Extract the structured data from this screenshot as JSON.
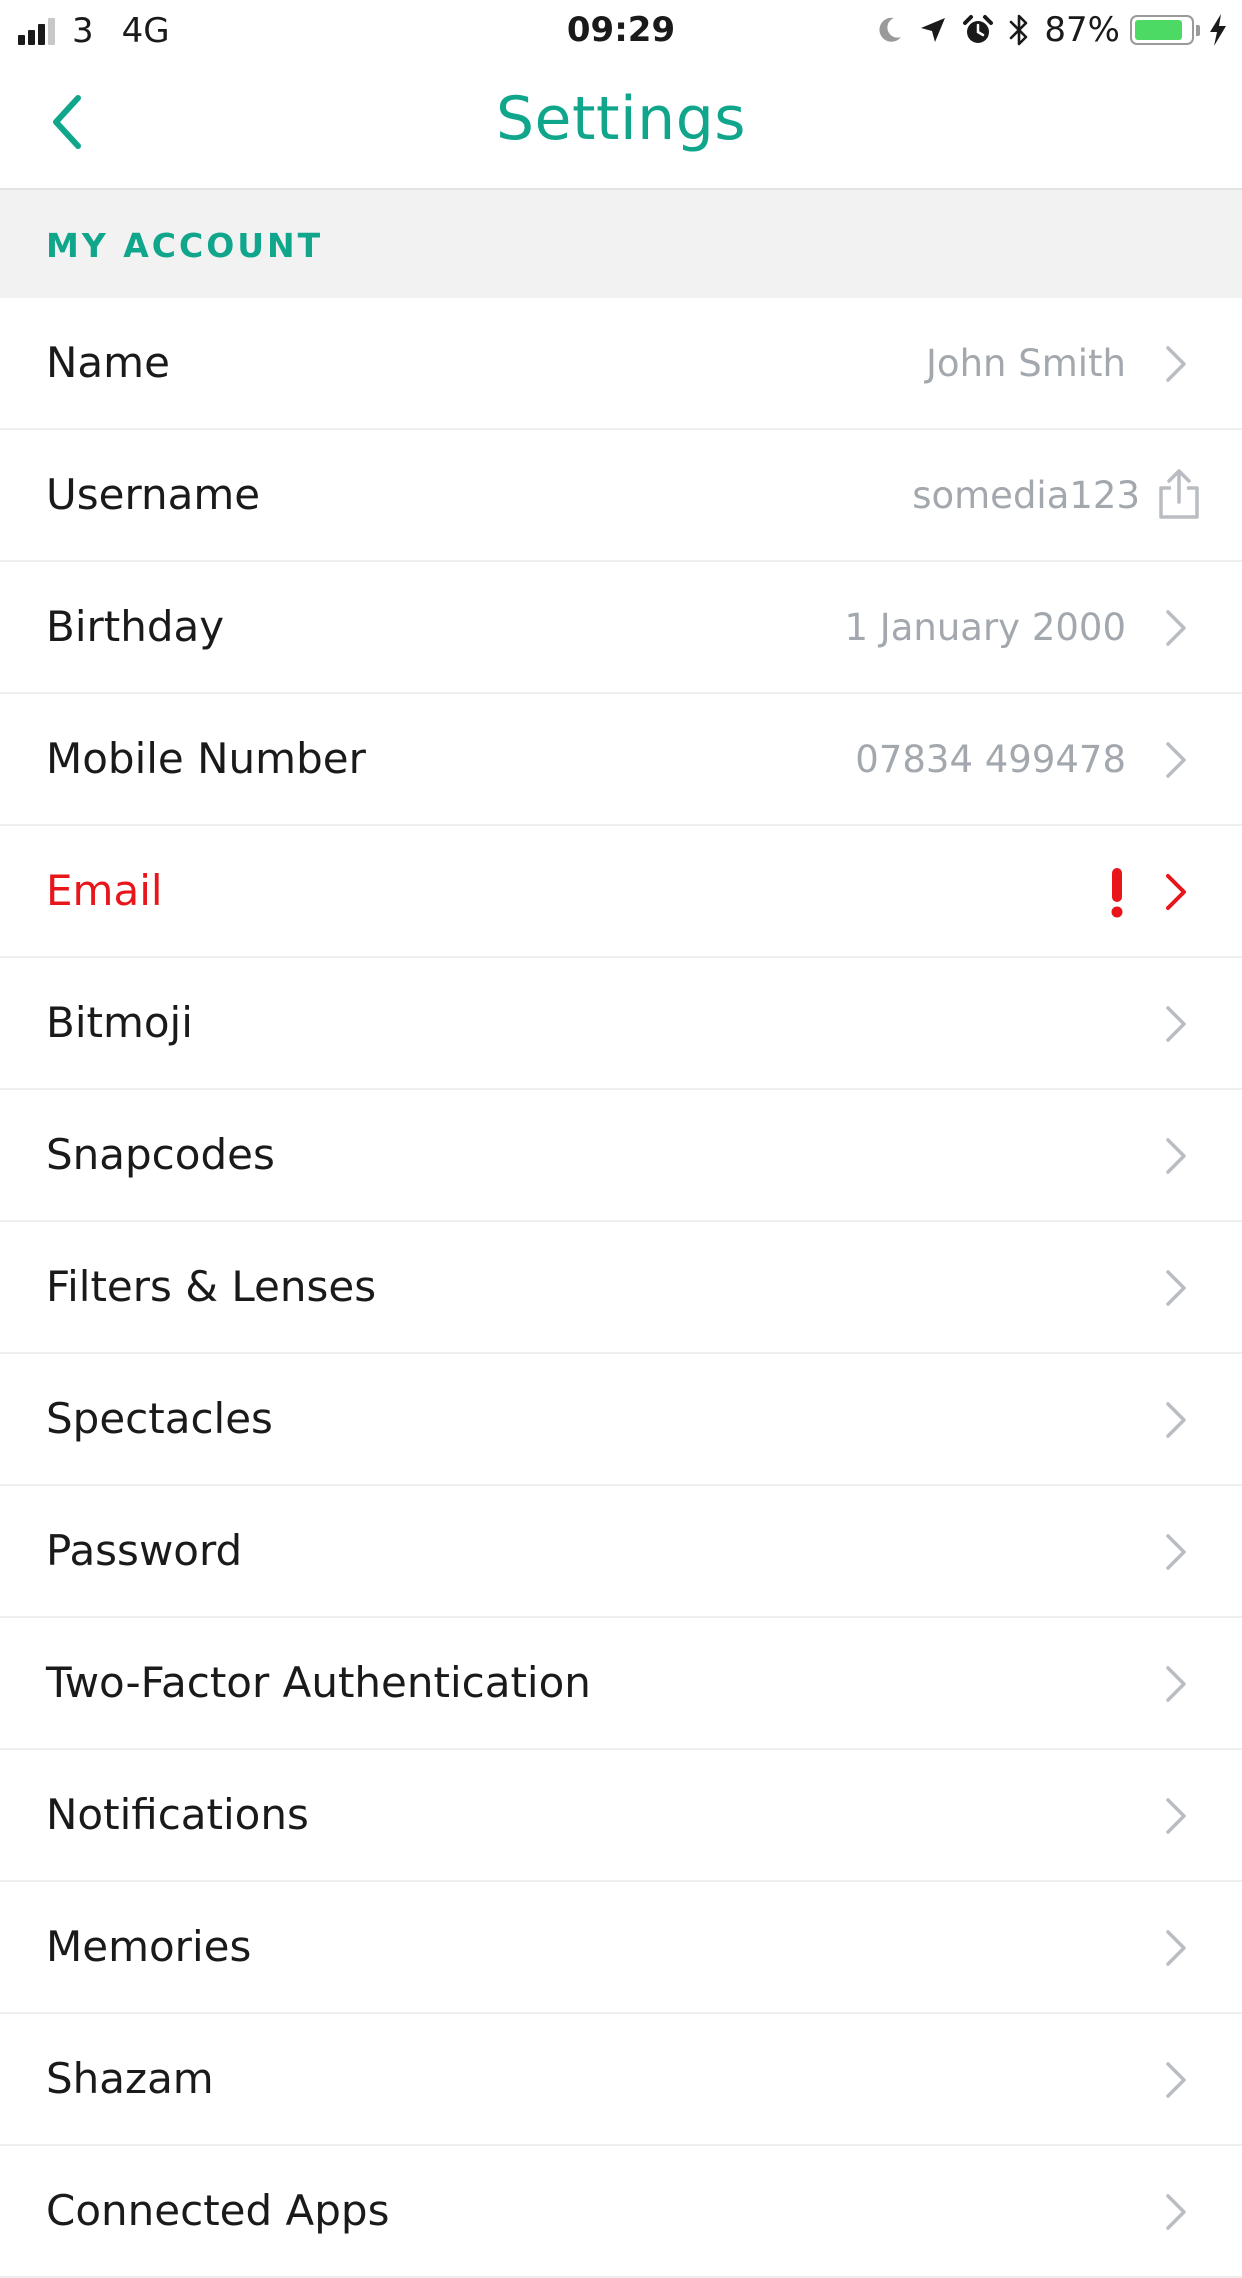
{
  "status_bar": {
    "carrier": "3",
    "network": "4G",
    "time": "09:29",
    "battery_percent": "87%",
    "battery_level": 0.87,
    "signal_bars": 4,
    "signal_bars_active": 3,
    "icons": [
      "moon-icon",
      "location-arrow-icon",
      "alarm-clock-icon",
      "bluetooth-icon",
      "battery-icon",
      "charging-bolt-icon"
    ]
  },
  "nav": {
    "title": "Settings",
    "back_icon": "chevron-left-icon"
  },
  "section": {
    "title": "MY ACCOUNT"
  },
  "rows": [
    {
      "label": "Name",
      "value": "John Smith",
      "accessory": "chevron"
    },
    {
      "label": "Username",
      "value": "somedia123",
      "accessory": "share"
    },
    {
      "label": "Birthday",
      "value": "1 January 2000",
      "accessory": "chevron"
    },
    {
      "label": "Mobile Number",
      "value": "07834 499478",
      "accessory": "chevron"
    },
    {
      "label": "Email",
      "value": "",
      "accessory": "alert-chevron"
    },
    {
      "label": "Bitmoji",
      "value": "",
      "accessory": "chevron"
    },
    {
      "label": "Snapcodes",
      "value": "",
      "accessory": "chevron"
    },
    {
      "label": "Filters & Lenses",
      "value": "",
      "accessory": "chevron"
    },
    {
      "label": "Spectacles",
      "value": "",
      "accessory": "chevron"
    },
    {
      "label": "Password",
      "value": "",
      "accessory": "chevron"
    },
    {
      "label": "Two-Factor Authentication",
      "value": "",
      "accessory": "chevron"
    },
    {
      "label": "Notifications",
      "value": "",
      "accessory": "chevron"
    },
    {
      "label": "Memories",
      "value": "",
      "accessory": "chevron"
    },
    {
      "label": "Shazam",
      "value": "",
      "accessory": "chevron"
    },
    {
      "label": "Connected Apps",
      "value": "",
      "accessory": "chevron"
    }
  ],
  "colors": {
    "accent": "#0fa68c",
    "alert": "#e8151b",
    "value_text": "#a3a8ae",
    "chevron": "#b9bdc2",
    "battery_fill": "#4cd964",
    "section_bg": "#f2f2f2"
  }
}
